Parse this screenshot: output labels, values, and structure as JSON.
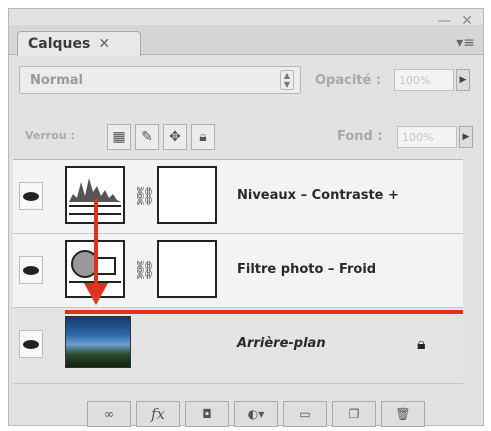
{
  "panel": {
    "tab_label": "Calques",
    "tab_close": "✕",
    "minimize": "—",
    "close": "✕",
    "menu": "▾≡"
  },
  "blend": {
    "mode": "Normal",
    "opacity_label": "Opacité :",
    "opacity_value": "100%"
  },
  "lock": {
    "label": "Verrou :",
    "fill_label": "Fond :",
    "fill_value": "100%"
  },
  "layers": [
    {
      "name": "Niveaux – Contraste +",
      "type": "adjustment"
    },
    {
      "name": "Filtre photo – Froid",
      "type": "adjustment"
    },
    {
      "name": "Arrière-plan",
      "type": "background",
      "locked": true
    }
  ],
  "colors": {
    "accent_red": "#e0321e"
  },
  "bottom_buttons": [
    "link-icon",
    "fx",
    "mask-icon",
    "adjustment-icon",
    "folder-icon",
    "new-layer-icon",
    "trash-icon"
  ],
  "fx_label": "fx"
}
